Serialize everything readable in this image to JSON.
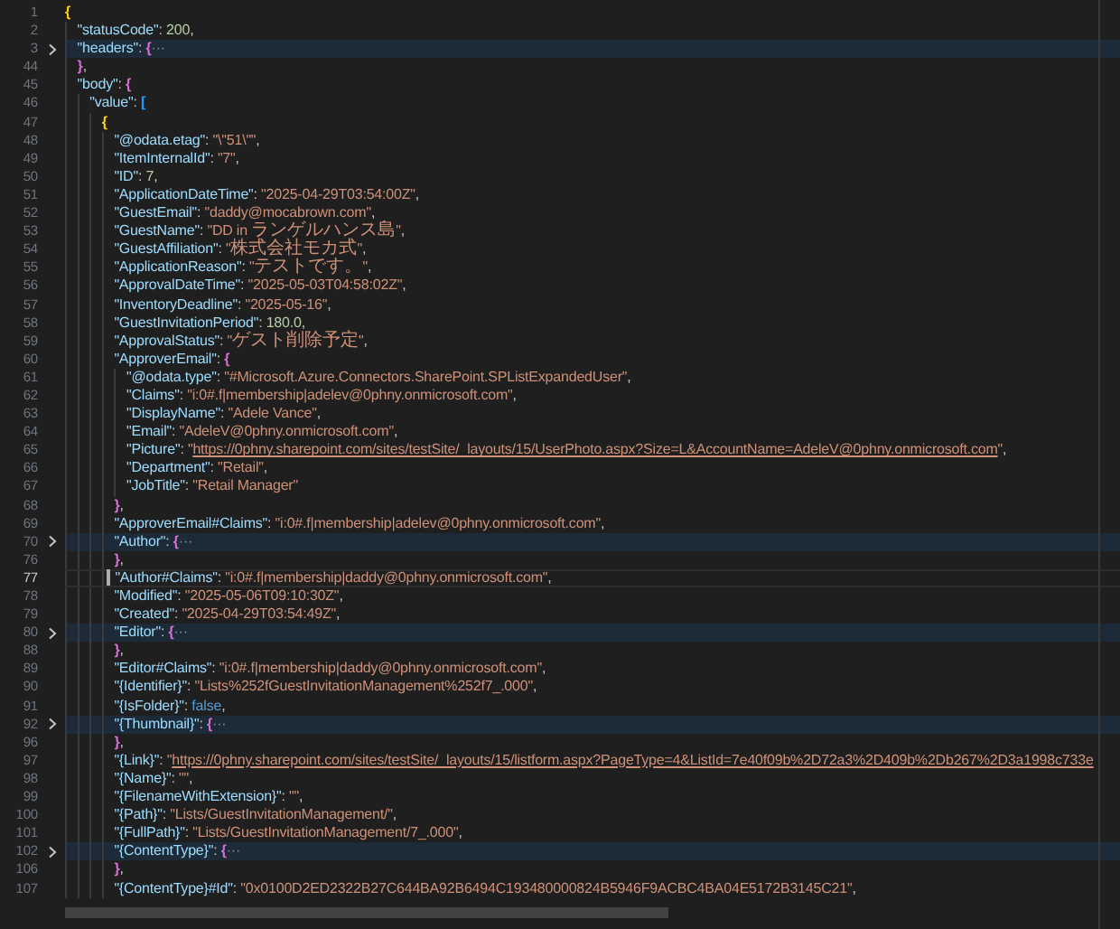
{
  "editor": {
    "lines": [
      {
        "number": "1",
        "folded": false,
        "current": false,
        "tokens": [
          {
            "kind": "bracket",
            "text": "{",
            "color": "#ffd700"
          }
        ],
        "children": [
          {
            "number": "2",
            "folded": false,
            "current": false,
            "tokens": [
              {
                "kind": "key",
                "text": "\"statusCode\""
              },
              {
                "kind": "punct",
                "text": ": "
              },
              {
                "kind": "number",
                "text": "200"
              },
              {
                "kind": "punct",
                "text": ","
              }
            ]
          },
          {
            "number": "3",
            "folded": true,
            "current": false,
            "tokens": [
              {
                "kind": "key",
                "text": "\"headers\""
              },
              {
                "kind": "punct",
                "text": ": "
              },
              {
                "kind": "bracket",
                "text": "{",
                "color": "#da70d6"
              },
              {
                "kind": "fold",
                "text": "···"
              }
            ]
          },
          {
            "number": "44",
            "folded": false,
            "current": false,
            "tokens": [
              {
                "kind": "bracket",
                "text": "}",
                "color": "#da70d6"
              },
              {
                "kind": "punct",
                "text": ","
              }
            ]
          },
          {
            "number": "45",
            "folded": false,
            "current": false,
            "tokens": [
              {
                "kind": "key",
                "text": "\"body\""
              },
              {
                "kind": "punct",
                "text": ": "
              },
              {
                "kind": "bracket",
                "text": "{",
                "color": "#da70d6"
              }
            ],
            "children": [
              {
                "number": "46",
                "folded": false,
                "current": false,
                "tokens": [
                  {
                    "kind": "key",
                    "text": "\"value\""
                  },
                  {
                    "kind": "punct",
                    "text": ": "
                  },
                  {
                    "kind": "bracket",
                    "text": "[",
                    "color": "#179fff"
                  }
                ],
                "children": [
                  {
                    "number": "47",
                    "folded": false,
                    "current": false,
                    "tokens": [
                      {
                        "kind": "bracket",
                        "text": "{",
                        "color": "#ffd700"
                      }
                    ],
                    "children": [
                      {
                        "number": "48",
                        "folded": false,
                        "current": false,
                        "tokens": [
                          {
                            "kind": "key",
                            "text": "\"@odata.etag\""
                          },
                          {
                            "kind": "punct",
                            "text": ": "
                          },
                          {
                            "kind": "string",
                            "text": "\"\\\"51\\\"\""
                          },
                          {
                            "kind": "punct",
                            "text": ","
                          }
                        ]
                      },
                      {
                        "number": "49",
                        "folded": false,
                        "current": false,
                        "tokens": [
                          {
                            "kind": "key",
                            "text": "\"ItemInternalId\""
                          },
                          {
                            "kind": "punct",
                            "text": ": "
                          },
                          {
                            "kind": "string",
                            "text": "\"7\""
                          },
                          {
                            "kind": "punct",
                            "text": ","
                          }
                        ]
                      },
                      {
                        "number": "50",
                        "folded": false,
                        "current": false,
                        "tokens": [
                          {
                            "kind": "key",
                            "text": "\"ID\""
                          },
                          {
                            "kind": "punct",
                            "text": ": "
                          },
                          {
                            "kind": "number",
                            "text": "7"
                          },
                          {
                            "kind": "punct",
                            "text": ","
                          }
                        ]
                      },
                      {
                        "number": "51",
                        "folded": false,
                        "current": false,
                        "tokens": [
                          {
                            "kind": "key",
                            "text": "\"ApplicationDateTime\""
                          },
                          {
                            "kind": "punct",
                            "text": ": "
                          },
                          {
                            "kind": "string",
                            "text": "\"2025-04-29T03:54:00Z\""
                          },
                          {
                            "kind": "punct",
                            "text": ","
                          }
                        ]
                      },
                      {
                        "number": "52",
                        "folded": false,
                        "current": false,
                        "tokens": [
                          {
                            "kind": "key",
                            "text": "\"GuestEmail\""
                          },
                          {
                            "kind": "punct",
                            "text": ": "
                          },
                          {
                            "kind": "string",
                            "text": "\"daddy@mocabrown.com\""
                          },
                          {
                            "kind": "punct",
                            "text": ","
                          }
                        ]
                      },
                      {
                        "number": "53",
                        "folded": false,
                        "current": false,
                        "tokens": [
                          {
                            "kind": "key",
                            "text": "\"GuestName\""
                          },
                          {
                            "kind": "punct",
                            "text": ": "
                          },
                          {
                            "kind": "string",
                            "text": "\"DD in ランゲルハンス島\""
                          },
                          {
                            "kind": "punct",
                            "text": ","
                          }
                        ]
                      },
                      {
                        "number": "54",
                        "folded": false,
                        "current": false,
                        "tokens": [
                          {
                            "kind": "key",
                            "text": "\"GuestAffiliation\""
                          },
                          {
                            "kind": "punct",
                            "text": ": "
                          },
                          {
                            "kind": "string",
                            "text": "\"株式会社モカ式\""
                          },
                          {
                            "kind": "punct",
                            "text": ","
                          }
                        ]
                      },
                      {
                        "number": "55",
                        "folded": false,
                        "current": false,
                        "tokens": [
                          {
                            "kind": "key",
                            "text": "\"ApplicationReason\""
                          },
                          {
                            "kind": "punct",
                            "text": ": "
                          },
                          {
                            "kind": "string",
                            "text": "\"テストです。\""
                          },
                          {
                            "kind": "punct",
                            "text": ","
                          }
                        ]
                      },
                      {
                        "number": "56",
                        "folded": false,
                        "current": false,
                        "tokens": [
                          {
                            "kind": "key",
                            "text": "\"ApprovalDateTime\""
                          },
                          {
                            "kind": "punct",
                            "text": ": "
                          },
                          {
                            "kind": "string",
                            "text": "\"2025-05-03T04:58:02Z\""
                          },
                          {
                            "kind": "punct",
                            "text": ","
                          }
                        ]
                      },
                      {
                        "number": "57",
                        "folded": false,
                        "current": false,
                        "tokens": [
                          {
                            "kind": "key",
                            "text": "\"InventoryDeadline\""
                          },
                          {
                            "kind": "punct",
                            "text": ": "
                          },
                          {
                            "kind": "string",
                            "text": "\"2025-05-16\""
                          },
                          {
                            "kind": "punct",
                            "text": ","
                          }
                        ]
                      },
                      {
                        "number": "58",
                        "folded": false,
                        "current": false,
                        "tokens": [
                          {
                            "kind": "key",
                            "text": "\"GuestInvitationPeriod\""
                          },
                          {
                            "kind": "punct",
                            "text": ": "
                          },
                          {
                            "kind": "number",
                            "text": "180.0"
                          },
                          {
                            "kind": "punct",
                            "text": ","
                          }
                        ]
                      },
                      {
                        "number": "59",
                        "folded": false,
                        "current": false,
                        "tokens": [
                          {
                            "kind": "key",
                            "text": "\"ApprovalStatus\""
                          },
                          {
                            "kind": "punct",
                            "text": ": "
                          },
                          {
                            "kind": "string",
                            "text": "\"ゲスト削除予定\""
                          },
                          {
                            "kind": "punct",
                            "text": ","
                          }
                        ]
                      },
                      {
                        "number": "60",
                        "folded": false,
                        "current": false,
                        "tokens": [
                          {
                            "kind": "key",
                            "text": "\"ApproverEmail\""
                          },
                          {
                            "kind": "punct",
                            "text": ": "
                          },
                          {
                            "kind": "bracket",
                            "text": "{",
                            "color": "#da70d6"
                          }
                        ],
                        "children": [
                          {
                            "number": "61",
                            "folded": false,
                            "current": false,
                            "tokens": [
                              {
                                "kind": "key",
                                "text": "\"@odata.type\""
                              },
                              {
                                "kind": "punct",
                                "text": ": "
                              },
                              {
                                "kind": "string",
                                "text": "\"#Microsoft.Azure.Connectors.SharePoint.SPListExpandedUser\""
                              },
                              {
                                "kind": "punct",
                                "text": ","
                              }
                            ]
                          },
                          {
                            "number": "62",
                            "folded": false,
                            "current": false,
                            "tokens": [
                              {
                                "kind": "key",
                                "text": "\"Claims\""
                              },
                              {
                                "kind": "punct",
                                "text": ": "
                              },
                              {
                                "kind": "string",
                                "text": "\"i:0#.f|membership|adelev@0phny.onmicrosoft.com\""
                              },
                              {
                                "kind": "punct",
                                "text": ","
                              }
                            ]
                          },
                          {
                            "number": "63",
                            "folded": false,
                            "current": false,
                            "tokens": [
                              {
                                "kind": "key",
                                "text": "\"DisplayName\""
                              },
                              {
                                "kind": "punct",
                                "text": ": "
                              },
                              {
                                "kind": "string",
                                "text": "\"Adele Vance\""
                              },
                              {
                                "kind": "punct",
                                "text": ","
                              }
                            ]
                          },
                          {
                            "number": "64",
                            "folded": false,
                            "current": false,
                            "tokens": [
                              {
                                "kind": "key",
                                "text": "\"Email\""
                              },
                              {
                                "kind": "punct",
                                "text": ": "
                              },
                              {
                                "kind": "string",
                                "text": "\"AdeleV@0phny.onmicrosoft.com\""
                              },
                              {
                                "kind": "punct",
                                "text": ","
                              }
                            ]
                          },
                          {
                            "number": "65",
                            "folded": false,
                            "current": false,
                            "tokens": [
                              {
                                "kind": "key",
                                "text": "\"Picture\""
                              },
                              {
                                "kind": "punct",
                                "text": ": "
                              },
                              {
                                "kind": "string",
                                "text": "\""
                              },
                              {
                                "kind": "link",
                                "text": "https://0phny.sharepoint.com/sites/testSite/_layouts/15/UserPhoto.aspx?Size=L&AccountName=AdeleV@0phny.onmicrosoft.com"
                              },
                              {
                                "kind": "string",
                                "text": "\""
                              },
                              {
                                "kind": "punct",
                                "text": ","
                              }
                            ]
                          },
                          {
                            "number": "66",
                            "folded": false,
                            "current": false,
                            "tokens": [
                              {
                                "kind": "key",
                                "text": "\"Department\""
                              },
                              {
                                "kind": "punct",
                                "text": ": "
                              },
                              {
                                "kind": "string",
                                "text": "\"Retail\""
                              },
                              {
                                "kind": "punct",
                                "text": ","
                              }
                            ]
                          },
                          {
                            "number": "67",
                            "folded": false,
                            "current": false,
                            "tokens": [
                              {
                                "kind": "key",
                                "text": "\"JobTitle\""
                              },
                              {
                                "kind": "punct",
                                "text": ": "
                              },
                              {
                                "kind": "string",
                                "text": "\"Retail Manager\""
                              }
                            ]
                          }
                        ]
                      },
                      {
                        "number": "68",
                        "folded": false,
                        "current": false,
                        "tokens": [
                          {
                            "kind": "bracket",
                            "text": "}",
                            "color": "#da70d6"
                          },
                          {
                            "kind": "punct",
                            "text": ","
                          }
                        ]
                      },
                      {
                        "number": "69",
                        "folded": false,
                        "current": false,
                        "tokens": [
                          {
                            "kind": "key",
                            "text": "\"ApproverEmail#Claims\""
                          },
                          {
                            "kind": "punct",
                            "text": ": "
                          },
                          {
                            "kind": "string",
                            "text": "\"i:0#.f|membership|adelev@0phny.onmicrosoft.com\""
                          },
                          {
                            "kind": "punct",
                            "text": ","
                          }
                        ]
                      },
                      {
                        "number": "70",
                        "folded": true,
                        "current": false,
                        "tokens": [
                          {
                            "kind": "key",
                            "text": "\"Author\""
                          },
                          {
                            "kind": "punct",
                            "text": ": "
                          },
                          {
                            "kind": "bracket",
                            "text": "{",
                            "color": "#da70d6"
                          },
                          {
                            "kind": "fold",
                            "text": "···"
                          }
                        ]
                      },
                      {
                        "number": "76",
                        "folded": false,
                        "current": false,
                        "tokens": [
                          {
                            "kind": "bracket",
                            "text": "}",
                            "color": "#da70d6"
                          },
                          {
                            "kind": "punct",
                            "text": ","
                          }
                        ]
                      },
                      {
                        "number": "77",
                        "folded": false,
                        "current": true,
                        "tokens": [
                          {
                            "kind": "key",
                            "text": "\"Author#Claims\""
                          },
                          {
                            "kind": "punct",
                            "text": ": "
                          },
                          {
                            "kind": "string",
                            "text": "\"i:0#.f|membership|daddy@0phny.onmicrosoft.com\""
                          },
                          {
                            "kind": "punct",
                            "text": ","
                          }
                        ]
                      },
                      {
                        "number": "78",
                        "folded": false,
                        "current": false,
                        "tokens": [
                          {
                            "kind": "key",
                            "text": "\"Modified\""
                          },
                          {
                            "kind": "punct",
                            "text": ": "
                          },
                          {
                            "kind": "string",
                            "text": "\"2025-05-06T09:10:30Z\""
                          },
                          {
                            "kind": "punct",
                            "text": ","
                          }
                        ]
                      },
                      {
                        "number": "79",
                        "folded": false,
                        "current": false,
                        "tokens": [
                          {
                            "kind": "key",
                            "text": "\"Created\""
                          },
                          {
                            "kind": "punct",
                            "text": ": "
                          },
                          {
                            "kind": "string",
                            "text": "\"2025-04-29T03:54:49Z\""
                          },
                          {
                            "kind": "punct",
                            "text": ","
                          }
                        ]
                      },
                      {
                        "number": "80",
                        "folded": true,
                        "current": false,
                        "tokens": [
                          {
                            "kind": "key",
                            "text": "\"Editor\""
                          },
                          {
                            "kind": "punct",
                            "text": ": "
                          },
                          {
                            "kind": "bracket",
                            "text": "{",
                            "color": "#da70d6"
                          },
                          {
                            "kind": "fold",
                            "text": "···"
                          }
                        ]
                      },
                      {
                        "number": "88",
                        "folded": false,
                        "current": false,
                        "tokens": [
                          {
                            "kind": "bracket",
                            "text": "}",
                            "color": "#da70d6"
                          },
                          {
                            "kind": "punct",
                            "text": ","
                          }
                        ]
                      },
                      {
                        "number": "89",
                        "folded": false,
                        "current": false,
                        "tokens": [
                          {
                            "kind": "key",
                            "text": "\"Editor#Claims\""
                          },
                          {
                            "kind": "punct",
                            "text": ": "
                          },
                          {
                            "kind": "string",
                            "text": "\"i:0#.f|membership|daddy@0phny.onmicrosoft.com\""
                          },
                          {
                            "kind": "punct",
                            "text": ","
                          }
                        ]
                      },
                      {
                        "number": "90",
                        "folded": false,
                        "current": false,
                        "tokens": [
                          {
                            "kind": "key",
                            "text": "\"{Identifier}\""
                          },
                          {
                            "kind": "punct",
                            "text": ": "
                          },
                          {
                            "kind": "string",
                            "text": "\"Lists%252fGuestInvitationManagement%252f7_.000\""
                          },
                          {
                            "kind": "punct",
                            "text": ","
                          }
                        ]
                      },
                      {
                        "number": "91",
                        "folded": false,
                        "current": false,
                        "tokens": [
                          {
                            "kind": "key",
                            "text": "\"{IsFolder}\""
                          },
                          {
                            "kind": "punct",
                            "text": ": "
                          },
                          {
                            "kind": "bool",
                            "text": "false"
                          },
                          {
                            "kind": "punct",
                            "text": ","
                          }
                        ]
                      },
                      {
                        "number": "92",
                        "folded": true,
                        "current": false,
                        "tokens": [
                          {
                            "kind": "key",
                            "text": "\"{Thumbnail}\""
                          },
                          {
                            "kind": "punct",
                            "text": ": "
                          },
                          {
                            "kind": "bracket",
                            "text": "{",
                            "color": "#da70d6"
                          },
                          {
                            "kind": "fold",
                            "text": "···"
                          }
                        ]
                      },
                      {
                        "number": "96",
                        "folded": false,
                        "current": false,
                        "tokens": [
                          {
                            "kind": "bracket",
                            "text": "}",
                            "color": "#da70d6"
                          },
                          {
                            "kind": "punct",
                            "text": ","
                          }
                        ]
                      },
                      {
                        "number": "97",
                        "folded": false,
                        "current": false,
                        "tokens": [
                          {
                            "kind": "key",
                            "text": "\"{Link}\""
                          },
                          {
                            "kind": "punct",
                            "text": ": "
                          },
                          {
                            "kind": "string",
                            "text": "\""
                          },
                          {
                            "kind": "link",
                            "text": "https://0phny.sharepoint.com/sites/testSite/_layouts/15/listform.aspx?PageType=4&ListId=7e40f09b%2D72a3%2D409b%2Db267%2D3a1998c733e"
                          }
                        ]
                      },
                      {
                        "number": "98",
                        "folded": false,
                        "current": false,
                        "tokens": [
                          {
                            "kind": "key",
                            "text": "\"{Name}\""
                          },
                          {
                            "kind": "punct",
                            "text": ": "
                          },
                          {
                            "kind": "string",
                            "text": "\"\""
                          },
                          {
                            "kind": "punct",
                            "text": ","
                          }
                        ]
                      },
                      {
                        "number": "99",
                        "folded": false,
                        "current": false,
                        "tokens": [
                          {
                            "kind": "key",
                            "text": "\"{FilenameWithExtension}\""
                          },
                          {
                            "kind": "punct",
                            "text": ": "
                          },
                          {
                            "kind": "string",
                            "text": "\"\""
                          },
                          {
                            "kind": "punct",
                            "text": ","
                          }
                        ]
                      },
                      {
                        "number": "100",
                        "folded": false,
                        "current": false,
                        "tokens": [
                          {
                            "kind": "key",
                            "text": "\"{Path}\""
                          },
                          {
                            "kind": "punct",
                            "text": ": "
                          },
                          {
                            "kind": "string",
                            "text": "\"Lists/GuestInvitationManagement/\""
                          },
                          {
                            "kind": "punct",
                            "text": ","
                          }
                        ]
                      },
                      {
                        "number": "101",
                        "folded": false,
                        "current": false,
                        "tokens": [
                          {
                            "kind": "key",
                            "text": "\"{FullPath}\""
                          },
                          {
                            "kind": "punct",
                            "text": ": "
                          },
                          {
                            "kind": "string",
                            "text": "\"Lists/GuestInvitationManagement/7_.000\""
                          },
                          {
                            "kind": "punct",
                            "text": ","
                          }
                        ]
                      },
                      {
                        "number": "102",
                        "folded": true,
                        "current": false,
                        "tokens": [
                          {
                            "kind": "key",
                            "text": "\"{ContentType}\""
                          },
                          {
                            "kind": "punct",
                            "text": ": "
                          },
                          {
                            "kind": "bracket",
                            "text": "{",
                            "color": "#da70d6"
                          },
                          {
                            "kind": "fold",
                            "text": "···"
                          }
                        ]
                      },
                      {
                        "number": "106",
                        "folded": false,
                        "current": false,
                        "tokens": [
                          {
                            "kind": "bracket",
                            "text": "}",
                            "color": "#da70d6"
                          },
                          {
                            "kind": "punct",
                            "text": ","
                          }
                        ]
                      },
                      {
                        "number": "107",
                        "folded": false,
                        "current": false,
                        "tokens": [
                          {
                            "kind": "key",
                            "text": "\"{ContentType}#Id\""
                          },
                          {
                            "kind": "punct",
                            "text": ": "
                          },
                          {
                            "kind": "string",
                            "text": "\"0x0100D2ED2322B27C644BA92B6494C193480000824B5946F9ACBC4BA04E5172B3145C21\""
                          },
                          {
                            "kind": "punct",
                            "text": ","
                          }
                        ]
                      }
                    ]
                  }
                ]
              }
            ]
          }
        ]
      }
    ]
  }
}
